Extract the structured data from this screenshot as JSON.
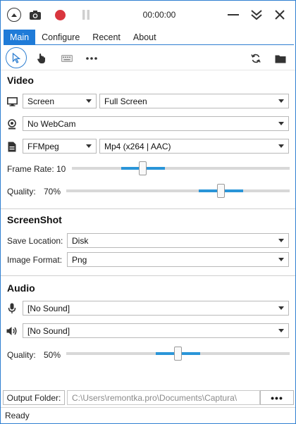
{
  "titlebar": {
    "timer": "00:00:00",
    "icons": [
      "collapse-up-icon",
      "camera-icon",
      "record-icon",
      "pause-icon",
      "minimize-icon",
      "chevrons-down-icon",
      "close-icon"
    ],
    "record_color": "#d9363e",
    "pause_color": "#d0d0d0"
  },
  "tabs": [
    {
      "label": "Main",
      "active": true
    },
    {
      "label": "Configure",
      "active": false
    },
    {
      "label": "Recent",
      "active": false
    },
    {
      "label": "About",
      "active": false
    }
  ],
  "toolbar": {
    "left_tools": [
      "cursor-icon",
      "hand-icon",
      "keyboard-icon",
      "more-icon"
    ],
    "right_tools": [
      "refresh-icon",
      "folder-icon"
    ]
  },
  "video": {
    "title": "Video",
    "source": "Screen",
    "region": "Full Screen",
    "webcam": "No WebCam",
    "encoder": "FFMpeg",
    "format": "Mp4 (x264 | AAC)",
    "frame_rate_label": "Frame Rate:",
    "frame_rate_value": "10",
    "frame_rate_fraction": 0.32,
    "quality_label": "Quality:",
    "quality_value": "70%",
    "quality_fraction": 0.7
  },
  "screenshot": {
    "title": "ScreenShot",
    "save_location_label": "Save Location:",
    "save_location": "Disk",
    "image_format_label": "Image Format:",
    "image_format": "Png"
  },
  "audio": {
    "title": "Audio",
    "microphone": "[No Sound]",
    "speaker": "[No Sound]",
    "quality_label": "Quality:",
    "quality_value": "50%",
    "quality_fraction": 0.5
  },
  "output": {
    "label": "Output Folder:",
    "path": "C:\\Users\\remontka.pro\\Documents\\Captura\\",
    "browse_label": "•••"
  },
  "status": "Ready",
  "colors": {
    "accent": "#1f7bd8",
    "slider_fill": "#2a95d8"
  }
}
